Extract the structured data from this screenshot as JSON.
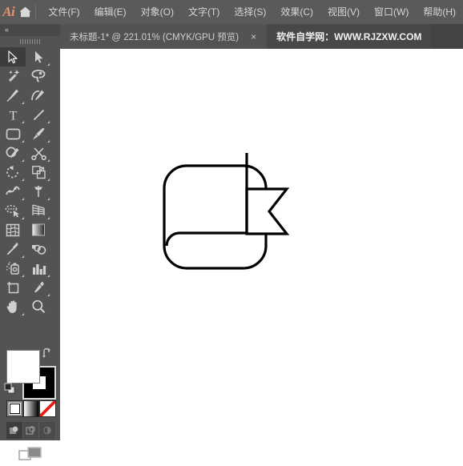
{
  "app": {
    "name": "Adobe Illustrator",
    "logo_text": "Ai",
    "home_icon": "home-icon"
  },
  "menubar": {
    "items": [
      {
        "label": "文件(F)",
        "name": "menu-file"
      },
      {
        "label": "编辑(E)",
        "name": "menu-edit"
      },
      {
        "label": "对象(O)",
        "name": "menu-object"
      },
      {
        "label": "文字(T)",
        "name": "menu-type"
      },
      {
        "label": "选择(S)",
        "name": "menu-select"
      },
      {
        "label": "效果(C)",
        "name": "menu-effect"
      },
      {
        "label": "视图(V)",
        "name": "menu-view"
      },
      {
        "label": "窗口(W)",
        "name": "menu-window"
      },
      {
        "label": "帮助(H)",
        "name": "menu-help"
      }
    ]
  },
  "tabs": {
    "active": {
      "title": "未标题-1* @ 221.01% (CMYK/GPU 预览)",
      "close_label": "×"
    },
    "extra": {
      "title": "软件自学网：WWW.RJZXW.COM"
    }
  },
  "toolpanel": {
    "collapse_label": "«",
    "tools": [
      {
        "name": "selection-tool",
        "label": "选择工具",
        "selected": true,
        "corner": false
      },
      {
        "name": "direct-selection-tool",
        "label": "直接选择工具",
        "selected": false,
        "corner": true
      },
      {
        "name": "magic-wand-tool",
        "label": "魔棒工具",
        "selected": false,
        "corner": false
      },
      {
        "name": "lasso-tool",
        "label": "套索工具",
        "selected": false,
        "corner": false
      },
      {
        "name": "pen-tool",
        "label": "钢笔工具",
        "selected": false,
        "corner": true
      },
      {
        "name": "curvature-tool",
        "label": "曲率工具",
        "selected": false,
        "corner": false
      },
      {
        "name": "type-tool",
        "label": "文字工具",
        "selected": false,
        "corner": true
      },
      {
        "name": "line-segment-tool",
        "label": "直线段工具",
        "selected": false,
        "corner": true
      },
      {
        "name": "rectangle-tool",
        "label": "矩形工具",
        "selected": false,
        "corner": true
      },
      {
        "name": "paintbrush-tool",
        "label": "画笔工具",
        "selected": false,
        "corner": true
      },
      {
        "name": "shaper-tool",
        "label": "Shaper 工具",
        "selected": false,
        "corner": true
      },
      {
        "name": "scissors-tool",
        "label": "剪刀工具",
        "selected": false,
        "corner": true
      },
      {
        "name": "rotate-tool",
        "label": "旋转工具",
        "selected": false,
        "corner": true
      },
      {
        "name": "scale-tool",
        "label": "比例缩放工具",
        "selected": false,
        "corner": true
      },
      {
        "name": "width-tool",
        "label": "宽度工具",
        "selected": false,
        "corner": true
      },
      {
        "name": "free-transform-tool",
        "label": "自由变换工具",
        "selected": false,
        "corner": true
      },
      {
        "name": "shape-builder-tool",
        "label": "形状生成器工具",
        "selected": false,
        "corner": true
      },
      {
        "name": "perspective-grid-tool",
        "label": "透视网格工具",
        "selected": false,
        "corner": true
      },
      {
        "name": "mesh-tool",
        "label": "网格工具",
        "selected": false,
        "corner": false
      },
      {
        "name": "gradient-tool",
        "label": "渐变工具",
        "selected": false,
        "corner": false
      },
      {
        "name": "eyedropper-tool",
        "label": "吸管工具",
        "selected": false,
        "corner": true
      },
      {
        "name": "blend-tool",
        "label": "混合工具",
        "selected": false,
        "corner": false
      },
      {
        "name": "symbol-sprayer-tool",
        "label": "符号喷枪工具",
        "selected": false,
        "corner": true
      },
      {
        "name": "column-graph-tool",
        "label": "柱形图工具",
        "selected": false,
        "corner": true
      },
      {
        "name": "artboard-tool",
        "label": "画板工具",
        "selected": false,
        "corner": false
      },
      {
        "name": "slice-tool",
        "label": "切片工具",
        "selected": false,
        "corner": true
      },
      {
        "name": "hand-tool",
        "label": "抓手工具",
        "selected": false,
        "corner": true
      },
      {
        "name": "zoom-tool",
        "label": "缩放工具",
        "selected": false,
        "corner": false
      }
    ],
    "colors": {
      "fill": "#ffffff",
      "stroke": "#000000",
      "fill_label": "填色",
      "stroke_label": "描边",
      "swap_icon": "swap-fill-stroke-icon",
      "default_icon": "default-fill-stroke-icon",
      "modes": [
        {
          "name": "color-swatch-button",
          "label": "颜色"
        },
        {
          "name": "gradient-swatch-button",
          "label": "渐变"
        },
        {
          "name": "none-swatch-button",
          "label": "无"
        }
      ],
      "draw_modes": [
        {
          "name": "draw-normal-button",
          "label": "正常绘图",
          "selected": true
        },
        {
          "name": "draw-behind-button",
          "label": "背面绘图",
          "selected": false
        },
        {
          "name": "draw-inside-button",
          "label": "内部绘图",
          "selected": false
        }
      ],
      "screen_mode": {
        "name": "change-screen-mode-button",
        "label": "更改屏幕模式"
      }
    }
  },
  "canvas": {
    "zoom_level": "221.01%",
    "color_mode": "CMYK",
    "preview_mode": "GPU 预览",
    "artwork": {
      "name": "book-bookmark-outline",
      "stroke_color": "#000000",
      "fill_color": "#ffffff",
      "stroke_width": 3
    }
  }
}
